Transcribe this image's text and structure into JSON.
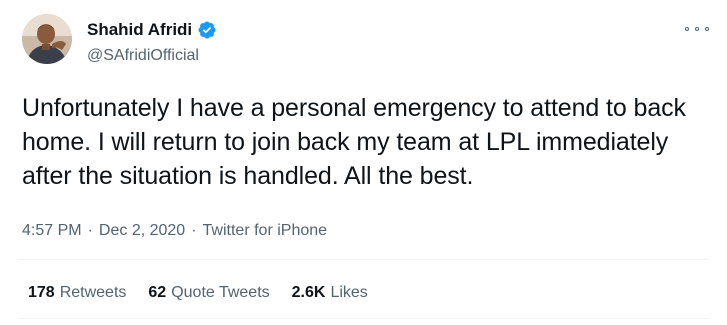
{
  "author": {
    "display_name": "Shahid Afridi",
    "handle": "@SAfridiOfficial",
    "verified": true,
    "verified_color": "#1d9bf0"
  },
  "tweet": {
    "text": "Unfortunately I have a personal emergency to attend to back home. I will return to join back my team at LPL immediately after the situation is handled. All the best.",
    "time": "4:57 PM",
    "separator": "·",
    "date": "Dec 2, 2020",
    "source": "Twitter for iPhone"
  },
  "stats": {
    "retweets_count": "178",
    "retweets_label": "Retweets",
    "quote_count": "62",
    "quote_label": "Quote Tweets",
    "likes_count": "2.6K",
    "likes_label": "Likes"
  },
  "icons": {
    "more": "more-options-icon",
    "verified": "verified-badge-icon"
  }
}
